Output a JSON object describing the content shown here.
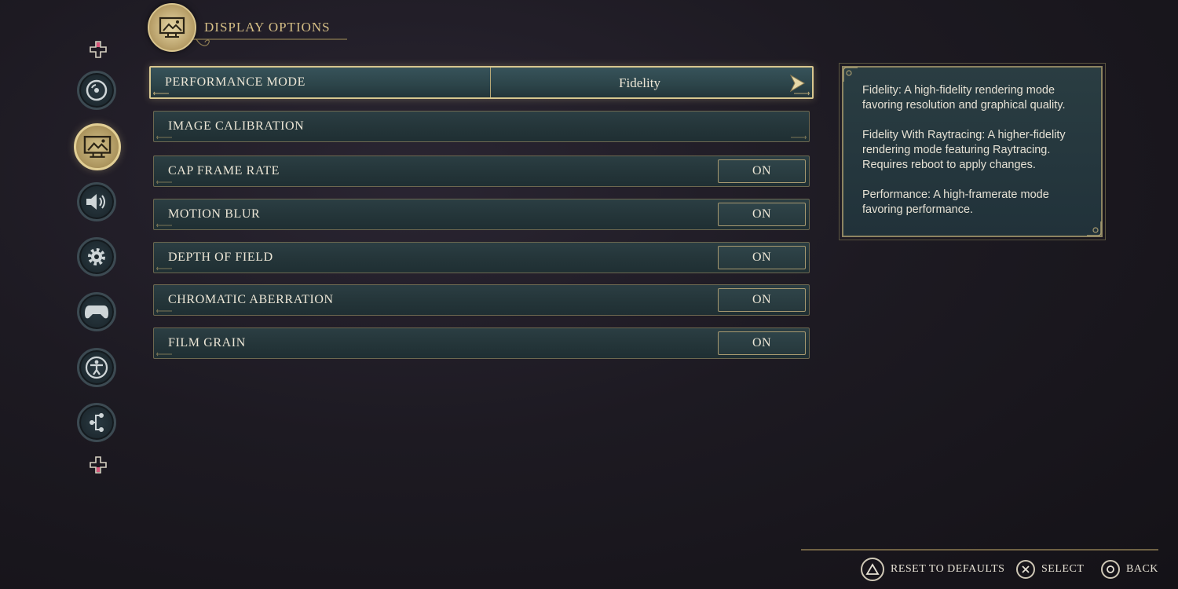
{
  "header": {
    "title": "DISPLAY OPTIONS",
    "icon": "display-icon"
  },
  "sidebar": {
    "items": [
      {
        "name": "disc-icon",
        "active": false
      },
      {
        "name": "display-icon",
        "active": true
      },
      {
        "name": "speaker-icon",
        "active": false
      },
      {
        "name": "gear-icon",
        "active": false
      },
      {
        "name": "controller-icon",
        "active": false
      },
      {
        "name": "accessibility-icon",
        "active": false
      },
      {
        "name": "network-icon",
        "active": false
      }
    ]
  },
  "settings": [
    {
      "label": "PERFORMANCE MODE",
      "value": "Fidelity",
      "type": "selector"
    },
    {
      "label": "IMAGE CALIBRATION",
      "value": "",
      "type": "link"
    },
    {
      "label": "CAP FRAME RATE",
      "value": "ON",
      "type": "toggle"
    },
    {
      "label": "MOTION BLUR",
      "value": "ON",
      "type": "toggle"
    },
    {
      "label": "DEPTH OF FIELD",
      "value": "ON",
      "type": "toggle"
    },
    {
      "label": "CHROMATIC ABERRATION",
      "value": "ON",
      "type": "toggle"
    },
    {
      "label": "FILM GRAIN",
      "value": "ON",
      "type": "toggle"
    }
  ],
  "info": {
    "paragraphs": [
      "Fidelity: A high-fidelity rendering mode favoring resolution and graphical quality.",
      "Fidelity With Raytracing: A higher-fidelity rendering mode featuring Raytracing. Requires reboot to apply changes.",
      "Performance: A high-framerate mode favoring performance."
    ]
  },
  "footer": {
    "reset_label": "RESET TO DEFAULTS",
    "select_label": "SELECT",
    "back_label": "BACK",
    "reset_button": "triangle-icon",
    "select_button": "cross-icon",
    "back_button": "circle-icon"
  },
  "colors": {
    "accent_gold": "#d8c78f",
    "row_teal": "#2b3e43",
    "background": "#1d1a22"
  }
}
